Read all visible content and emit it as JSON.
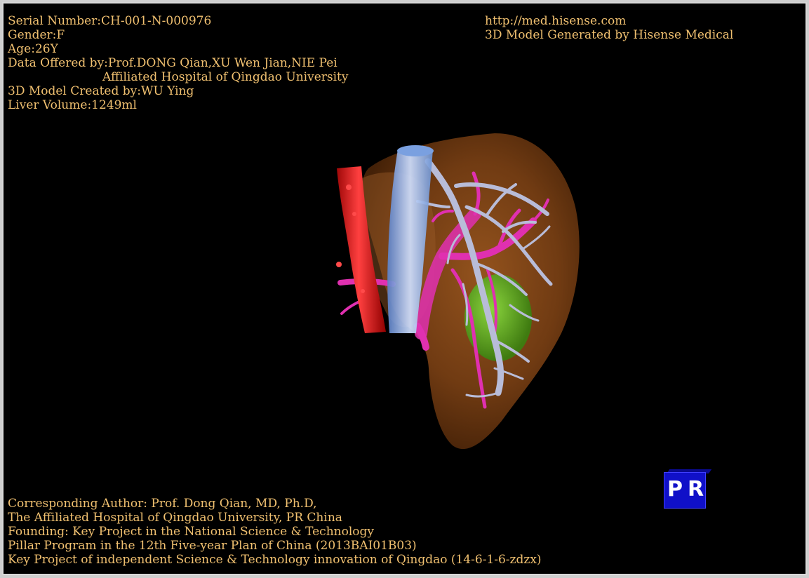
{
  "info": {
    "serial": "Serial Number:CH-001-N-000976",
    "gender": "Gender:F",
    "age": "Age:26Y",
    "data_offered": "Data Offered by:Prof.DONG Qian,XU Wen Jian,NIE Pei",
    "hospital": "Affiliated Hospital of Qingdao University",
    "created_by": "3D Model Created by:WU Ying",
    "liver_volume": "Liver Volume:1249ml"
  },
  "brand": {
    "url": "http://med.hisense.com",
    "generator": "3D Model Generated by Hisense Medical"
  },
  "footer": {
    "line1": "Corresponding Author: Prof. Dong Qian, MD, Ph.D,",
    "line2": "The Affiliated Hospital of Qingdao University, PR China",
    "line3": "Founding: Key Project in the National Science & Technology",
    "line4": "Pillar Program in the 12th Five-year Plan of China (2013BAI01B03)",
    "line5": "Key Project of independent Science & Technology innovation of Qingdao (14-6-1-6-zdzx)"
  },
  "orientation_cube": {
    "left_label": "P",
    "right_label": "R"
  },
  "colors": {
    "text": "#f0c070",
    "background": "#000000",
    "liver": "#8a4a18",
    "gallbladder": "#6ab82a",
    "aorta": "#e01818",
    "vena_cava": "#a8c4f0",
    "portal_vein": "#e030b0",
    "hepatic_vein": "#b8bcd8",
    "cube": "#1010c8"
  }
}
